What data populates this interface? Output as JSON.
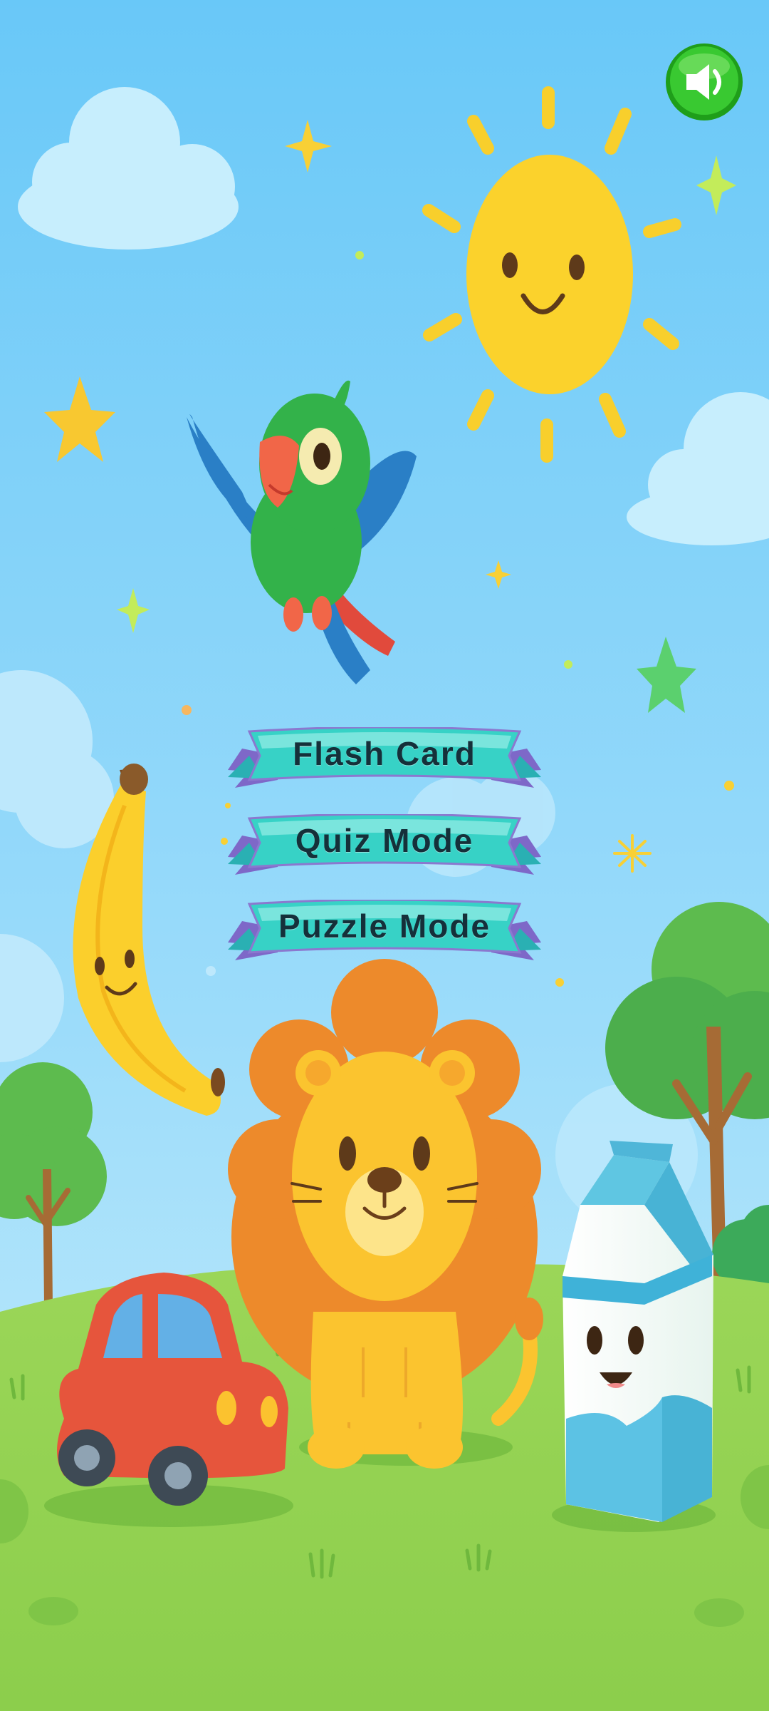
{
  "menu": {
    "items": [
      {
        "label": "Flash Card"
      },
      {
        "label": "Quiz Mode"
      },
      {
        "label": "Puzzle Mode"
      }
    ]
  },
  "sound_button": {
    "icon": "speaker-icon",
    "state": "on"
  },
  "colors": {
    "sky_top": "#6ac9f8",
    "sky_bottom": "#bfeafc",
    "grass": "#8fd150",
    "button_teal": "#36d0c4",
    "button_ribbon": "#7e68c8",
    "sound_green": "#34c92c"
  },
  "scene_items": [
    "sun",
    "parrot",
    "banana",
    "lion",
    "car",
    "milk-carton",
    "trees",
    "clouds",
    "stars"
  ]
}
